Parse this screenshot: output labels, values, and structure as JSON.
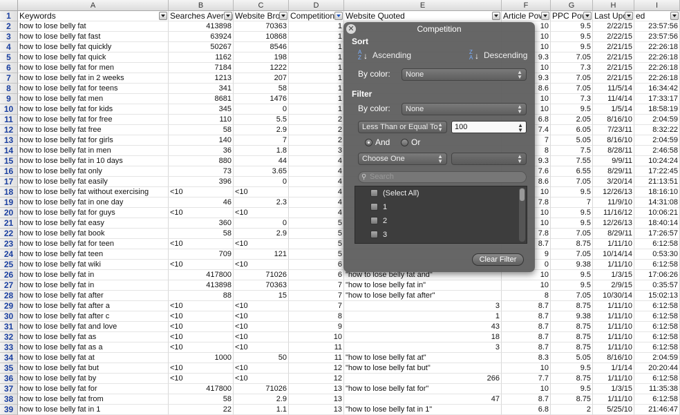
{
  "columns": [
    {
      "letter": "A",
      "header": "Keywords"
    },
    {
      "letter": "B",
      "header": "Searches Averag"
    },
    {
      "letter": "C",
      "header": "Website Broa"
    },
    {
      "letter": "D",
      "header": "Competition"
    },
    {
      "letter": "E",
      "header": "Website Quoted"
    },
    {
      "letter": "F",
      "header": "Article Pow"
    },
    {
      "letter": "G",
      "header": "PPC Pow"
    },
    {
      "letter": "H",
      "header": "Last Upd"
    },
    {
      "letter": "I",
      "header": "ed"
    }
  ],
  "rows": [
    [
      "2",
      "how to lose belly fat",
      "413898",
      "70363",
      "1",
      "",
      "10",
      "9.5",
      "2/22/15",
      "23:57:56"
    ],
    [
      "3",
      "how to lose belly fat fast",
      "63924",
      "10868",
      "1",
      "",
      "10",
      "9.5",
      "2/22/15",
      "23:57:56"
    ],
    [
      "4",
      "how to lose belly fat quickly",
      "50267",
      "8546",
      "1",
      "",
      "10",
      "9.5",
      "2/21/15",
      "22:26:18"
    ],
    [
      "5",
      "how to lose belly fat quick",
      "1162",
      "198",
      "1",
      "",
      "9.3",
      "7.05",
      "2/21/15",
      "22:26:18"
    ],
    [
      "6",
      "how to lose belly fat for men",
      "7184",
      "1222",
      "1",
      "",
      "10",
      "7.3",
      "2/21/15",
      "22:26:18"
    ],
    [
      "7",
      "how to lose belly fat in 2 weeks",
      "1213",
      "207",
      "1",
      "",
      "9.3",
      "7.05",
      "2/21/15",
      "22:26:18"
    ],
    [
      "8",
      "how to lose belly fat for teens",
      "341",
      "58",
      "1",
      "",
      "8.6",
      "7.05",
      "11/5/14",
      "16:34:42"
    ],
    [
      "9",
      "how to lose belly fat men",
      "8681",
      "1476",
      "1",
      "",
      "10",
      "7.3",
      "11/4/14",
      "17:33:17"
    ],
    [
      "10",
      "how to lose belly fat for kids",
      "345",
      "0",
      "1",
      "",
      "10",
      "9.5",
      "1/5/14",
      "18:58:19"
    ],
    [
      "11",
      "how to lose belly fat for free",
      "110",
      "5.5",
      "2",
      "",
      "6.8",
      "2.05",
      "8/16/10",
      "2:04:59"
    ],
    [
      "12",
      "how to lose belly fat free",
      "58",
      "2.9",
      "2",
      "",
      "7.4",
      "6.05",
      "7/23/11",
      "8:32:22"
    ],
    [
      "13",
      "how to lose belly fat for girls",
      "140",
      "7",
      "2",
      "",
      "7",
      "5.05",
      "8/16/10",
      "2:04:59"
    ],
    [
      "14",
      "how to lose belly fat in men",
      "36",
      "1.8",
      "3",
      "",
      "8",
      "7.5",
      "8/28/11",
      "2:46:58"
    ],
    [
      "15",
      "how to lose belly fat in 10 days",
      "880",
      "44",
      "4",
      "",
      "9.3",
      "7.55",
      "9/9/11",
      "10:24:24"
    ],
    [
      "16",
      "how to lose belly fat only",
      "73",
      "3.65",
      "4",
      "",
      "7.6",
      "6.55",
      "8/29/11",
      "17:22:45"
    ],
    [
      "17",
      "how to lose belly fat easily",
      "396",
      "0",
      "4",
      "",
      "8.6",
      "7.05",
      "3/20/14",
      "21:13:51"
    ],
    [
      "18",
      "how to lose belly fat without exercising",
      "<10",
      "<10",
      "4",
      "",
      "10",
      "9.5",
      "12/26/13",
      "18:16:10"
    ],
    [
      "19",
      "how to lose belly fat in one day",
      "46",
      "2.3",
      "4",
      "",
      "7.8",
      "7",
      "11/9/10",
      "14:31:08"
    ],
    [
      "20",
      "how to lose belly fat for guys",
      "<10",
      "<10",
      "4",
      "",
      "10",
      "9.5",
      "11/16/12",
      "10:06:21"
    ],
    [
      "21",
      "how to lose belly fat easy",
      "360",
      "0",
      "5",
      "",
      "10",
      "9.5",
      "12/26/13",
      "18:40:14"
    ],
    [
      "22",
      "how to lose belly fat book",
      "58",
      "2.9",
      "5",
      "",
      "7.8",
      "7.05",
      "8/29/11",
      "17:26:57"
    ],
    [
      "23",
      "how to lose belly fat for teen",
      "<10",
      "<10",
      "5",
      "",
      "8.7",
      "8.75",
      "1/11/10",
      "6:12:58"
    ],
    [
      "24",
      "how to lose belly fat teen",
      "709",
      "121",
      "5",
      "",
      "9",
      "7.05",
      "10/14/14",
      "0:53:30"
    ],
    [
      "25",
      "how to lose belly fat wiki",
      "<10",
      "<10",
      "6",
      "",
      "0",
      "9.38",
      "1/11/10",
      "6:12:58"
    ],
    [
      "26",
      "how to lose belly fat in",
      "417800",
      "71026",
      "6",
      "\"how to lose belly fat and\"",
      "10",
      "9.5",
      "1/3/15",
      "17:06:26"
    ],
    [
      "27",
      "how to lose belly fat in",
      "413898",
      "70363",
      "7",
      "\"how to lose belly fat in\"",
      "10",
      "9.5",
      "2/9/15",
      "0:35:57"
    ],
    [
      "28",
      "how to lose belly fat after",
      "88",
      "15",
      "7",
      "\"how to lose belly fat after\"",
      "8",
      "7.05",
      "10/30/14",
      "15:02:13"
    ],
    [
      "29",
      "how to lose belly fat after a",
      "<10",
      "<10",
      "7",
      "3",
      "8.7",
      "8.75",
      "1/11/10",
      "6:12:58"
    ],
    [
      "30",
      "how to lose belly fat after c",
      "<10",
      "<10",
      "8",
      "1",
      "8.7",
      "9.38",
      "1/11/10",
      "6:12:58"
    ],
    [
      "31",
      "how to lose belly fat and love",
      "<10",
      "<10",
      "9",
      "43",
      "8.7",
      "8.75",
      "1/11/10",
      "6:12:58"
    ],
    [
      "32",
      "how to lose belly fat as",
      "<10",
      "<10",
      "10",
      "18",
      "8.7",
      "8.75",
      "1/11/10",
      "6:12:58"
    ],
    [
      "33",
      "how to lose belly fat as a",
      "<10",
      "<10",
      "11",
      "3",
      "8.7",
      "8.75",
      "1/11/10",
      "6:12:58"
    ],
    [
      "34",
      "how to lose belly fat at",
      "1000",
      "50",
      "11",
      "\"how to lose belly fat at\"",
      "8.3",
      "5.05",
      "8/16/10",
      "2:04:59"
    ],
    [
      "35",
      "how to lose belly fat but",
      "<10",
      "<10",
      "12",
      "\"how to lose belly fat but\"",
      "10",
      "9.5",
      "1/1/14",
      "20:20:44"
    ],
    [
      "36",
      "how to lose belly fat by",
      "<10",
      "<10",
      "12",
      "266",
      "7.7",
      "8.75",
      "1/11/10",
      "6:12:58"
    ],
    [
      "37",
      "how to lose belly fat for",
      "417800",
      "71026",
      "13",
      "\"how to lose belly fat for\"",
      "10",
      "9.5",
      "1/3/15",
      "11:35:38"
    ],
    [
      "38",
      "how to lose belly fat from",
      "58",
      "2.9",
      "13",
      "47",
      "8.7",
      "8.75",
      "1/11/10",
      "6:12:58"
    ],
    [
      "39",
      "how to lose belly fat in 1",
      "22",
      "1.1",
      "13",
      "\"how to lose belly fat in 1\"",
      "6.8",
      "2",
      "5/25/10",
      "21:46:47"
    ]
  ],
  "popup": {
    "title": "Competition",
    "sort_label": "Sort",
    "ascending": "Ascending",
    "descending": "Descending",
    "by_color": "By color:",
    "sort_color_value": "None",
    "filter_label": "Filter",
    "filter_color_value": "None",
    "condition": "Less Than or Equal To",
    "condition_value": "100",
    "and_label": "And",
    "or_label": "Or",
    "second_condition": "Choose One",
    "search_placeholder": "Search",
    "list_items": [
      "(Select All)",
      "1",
      "2",
      "3"
    ],
    "clear_filter": "Clear Filter"
  }
}
